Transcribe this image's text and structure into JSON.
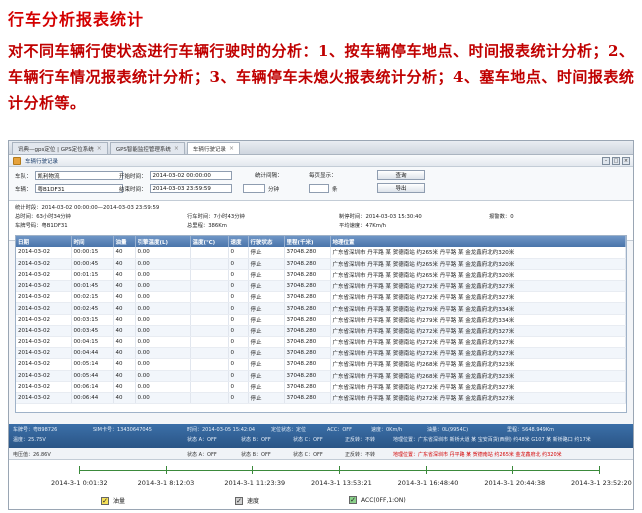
{
  "doc": {
    "title": "行车分析报表统计",
    "paragraph": "对不同车辆行使状态进行车辆行驶时的分析：1、按车辆停车地点、时间报表统计分析；2、车辆行车情况报表统计分析；3、车辆停车未熄火报表统计分析；4、塞车地点、时间报表统计分析等。"
  },
  "tabs": [
    {
      "label": "讯典—gps定位 | GPS定位系统"
    },
    {
      "label": "GPS智能监控管理系统"
    },
    {
      "label": "车辆行驶记录"
    }
  ],
  "window": {
    "title": "车辆行驶记录"
  },
  "filter": {
    "team_label": "车队：",
    "team_value": "凯利物流",
    "vehicle_label": "车辆：",
    "vehicle_value": "粤B1DF31",
    "start_label": "开始时间：",
    "start_value": "2014-03-02 00:00:00",
    "end_label": "结束时间：",
    "end_value": "2014-03-03 23:59:59",
    "stat_label": "统计间隔：",
    "stat_unit": "分钟",
    "speed_label": "每页显示：",
    "speed_unit": "条",
    "query_button": "查询",
    "export_button": "导出"
  },
  "summary": {
    "period": "统计时段：2014-03-02 00:00:00—2014-03-03 23:59:59",
    "total_time": "总时间：63小时34分钟",
    "drive_time": "行车时间：7小时43分钟",
    "stop_time": "制停时间：2014-03-03 15:30:40",
    "alarm": "报警数：0",
    "plate": "车牌号码：粤B1DF31",
    "mileage": "总里程：386Km",
    "avg_speed": "平均速度：47Km/h"
  },
  "table": {
    "headers": [
      "日期",
      "时间",
      "油量",
      "引擎温度(L)",
      "温度(℃)",
      "速度",
      "行驶状态",
      "里程(千米)",
      "地理位置"
    ],
    "rows": [
      [
        "2014-03-02",
        "00:00:15",
        "40",
        "0.00",
        "",
        "0",
        "停止",
        "37048.280",
        "广东省深圳市 丹平路 某 贺德南站 约265米 丹平路 某 金龙鑫府北约320米"
      ],
      [
        "2014-03-02",
        "00:00:45",
        "40",
        "0.00",
        "",
        "0",
        "停止",
        "37048.280",
        "广东省深圳市 丹平路 某 贺德南站 约265米 丹平路 某 金龙鑫府北约320米"
      ],
      [
        "2014-03-02",
        "00:01:15",
        "40",
        "0.00",
        "",
        "0",
        "停止",
        "37048.280",
        "广东省深圳市 丹平路 某 贺德南站 约265米 丹平路 某 金龙鑫府北约320米"
      ],
      [
        "2014-03-02",
        "00:01:45",
        "40",
        "0.00",
        "",
        "0",
        "停止",
        "37048.280",
        "广东省深圳市 丹平路 某 贺德南站 约272米 丹平路 某 金龙鑫府北约327米"
      ],
      [
        "2014-03-02",
        "00:02:15",
        "40",
        "0.00",
        "",
        "0",
        "停止",
        "37048.280",
        "广东省深圳市 丹平路 某 贺德南站 约272米 丹平路 某 金龙鑫府北约327米"
      ],
      [
        "2014-03-02",
        "00:02:45",
        "40",
        "0.00",
        "",
        "0",
        "停止",
        "37048.280",
        "广东省深圳市 丹平路 某 贺德南站 约279米 丹平路 某 金龙鑫府北约334米"
      ],
      [
        "2014-03-02",
        "00:03:15",
        "40",
        "0.00",
        "",
        "0",
        "停止",
        "37048.280",
        "广东省深圳市 丹平路 某 贺德南站 约279米 丹平路 某 金龙鑫府北约334米"
      ],
      [
        "2014-03-02",
        "00:03:45",
        "40",
        "0.00",
        "",
        "0",
        "停止",
        "37048.280",
        "广东省深圳市 丹平路 某 贺德南站 约272米 丹平路 某 金龙鑫府北约327米"
      ],
      [
        "2014-03-02",
        "00:04:15",
        "40",
        "0.00",
        "",
        "0",
        "停止",
        "37048.280",
        "广东省深圳市 丹平路 某 贺德南站 约272米 丹平路 某 金龙鑫府北约327米"
      ],
      [
        "2014-03-02",
        "00:04:44",
        "40",
        "0.00",
        "",
        "0",
        "停止",
        "37048.280",
        "广东省深圳市 丹平路 某 贺德南站 约272米 丹平路 某 金龙鑫府北约327米"
      ],
      [
        "2014-03-02",
        "00:05:14",
        "40",
        "0.00",
        "",
        "0",
        "停止",
        "37048.280",
        "广东省深圳市 丹平路 某 贺德南站 约268米 丹平路 某 金龙鑫府北约323米"
      ],
      [
        "2014-03-02",
        "00:05:44",
        "40",
        "0.00",
        "",
        "0",
        "停止",
        "37048.280",
        "广东省深圳市 丹平路 某 贺德南站 约268米 丹平路 某 金龙鑫府北约323米"
      ],
      [
        "2014-03-02",
        "00:06:14",
        "40",
        "0.00",
        "",
        "0",
        "停止",
        "37048.280",
        "广东省深圳市 丹平路 某 贺德南站 约272米 丹平路 某 金龙鑫府北约327米"
      ],
      [
        "2014-03-02",
        "00:06:44",
        "40",
        "0.00",
        "",
        "0",
        "停止",
        "37048.280",
        "广东省深圳市 丹平路 某 贺德南站 约272米 丹平路 某 金龙鑫府北约327米"
      ]
    ]
  },
  "status": {
    "plate": "车牌号：粤B98726",
    "sim": "SIM卡号：13430647045",
    "time": "时间：2014-03-05 15:42:04",
    "lock": "定位状态：定位",
    "acc": "ACC：OFF",
    "speed": "速度：0Km/h",
    "oil": "油量：0L(9954C)",
    "mileage": "里程：5648.949Km",
    "temp": "开关门：关",
    "pos": "经度：113.xxxx",
    "voltage": "温度：25.75V",
    "door": "状态 A：OFF",
    "s_b": "状态 B：OFF",
    "s_c": "状态 C：OFF",
    "zone": "正反转：不转",
    "address": "地理位置：广东省深圳市 新桥大道 某 宝安百货(西侧) 约48米 G107 某 新桥路口 约17米",
    "voltage2": "电压值：26.86V",
    "s2_a": "状态 A：OFF",
    "s2_b": "状态 B：OFF",
    "s2_c": "状态 C：OFF",
    "s2_zone": "正反转：不转",
    "address2": "地理位置：广东省深圳市 丹平路 某 贺德南站 约265米 金龙鑫府北 约320米"
  },
  "timeline": {
    "labels": [
      "2014-3-1 0:01:32",
      "2014-3-1 8:12:03",
      "2014-3-1 11:23:39",
      "2014-3-1 13:53:21",
      "2014-3-1 16:48:40",
      "2014-3-1 20:44:38",
      "2014-3-1 23:52:20"
    ],
    "legend": [
      {
        "label": "油量",
        "style": "yellow"
      },
      {
        "label": "速度",
        "style": "grey"
      },
      {
        "label": "ACC(0FF,1:ON)",
        "style": "green"
      }
    ]
  }
}
